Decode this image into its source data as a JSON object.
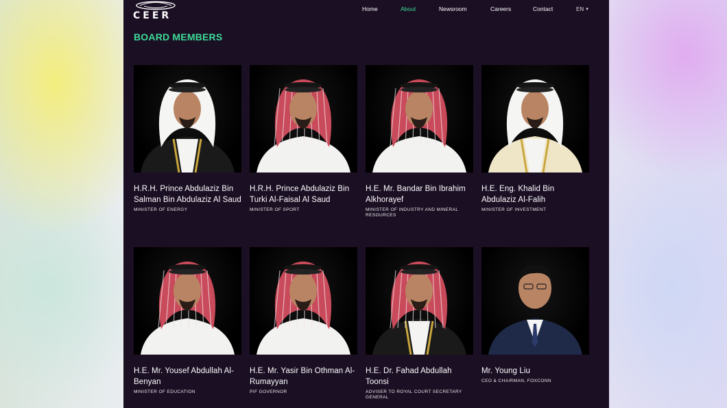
{
  "header": {
    "logo_text": "CEER",
    "nav": [
      {
        "label": "Home",
        "active": false
      },
      {
        "label": "About",
        "active": true
      },
      {
        "label": "Newsroom",
        "active": false
      },
      {
        "label": "Careers",
        "active": false
      },
      {
        "label": "Contact",
        "active": false
      }
    ],
    "language": "EN"
  },
  "section": {
    "title": "BOARD MEMBERS"
  },
  "members": [
    {
      "name": "H.R.H. Prince Abdulaziz Bin Salman Bin Abdulaziz Al Saud",
      "role": "MINISTER OF ENERGY",
      "attire": "white-ghutra",
      "robe": "black-bisht-gold"
    },
    {
      "name": "H.R.H. Prince Abdulaziz Bin Turki Al-Faisal Al Saud",
      "role": "MINISTER OF SPORT",
      "attire": "red-shemagh",
      "robe": "white-thobe"
    },
    {
      "name": "H.E. Mr. Bandar Bin Ibrahim Alkhorayef",
      "role": "MINISTER OF INDUSTRY AND MINERAL RESOURCES",
      "attire": "red-shemagh",
      "robe": "white-thobe"
    },
    {
      "name": "H.E. Eng. Khalid Bin Abdulaziz Al-Falih",
      "role": "MINISTER OF INVESTMENT",
      "attire": "white-ghutra",
      "robe": "cream-bisht-gold"
    },
    {
      "name": "H.E. Mr. Yousef Abdullah Al-Benyan",
      "role": "MINISTER OF EDUCATION",
      "attire": "red-shemagh",
      "robe": "white-thobe"
    },
    {
      "name": "H.E. Mr. Yasir Bin Othman Al-Rumayyan",
      "role": "PIF GOVERNOR",
      "attire": "red-shemagh",
      "robe": "white-thobe"
    },
    {
      "name": "H.E. Dr. Fahad Abdullah Toonsi",
      "role": "ADVISER TO ROYAL COURT SECRETARY GENERAL",
      "attire": "red-shemagh",
      "robe": "black-bisht-gold"
    },
    {
      "name": "Mr. Young Liu",
      "role": "CEO & CHAIRMAN, FOXCONN",
      "attire": "suit",
      "robe": "navy-suit"
    }
  ]
}
